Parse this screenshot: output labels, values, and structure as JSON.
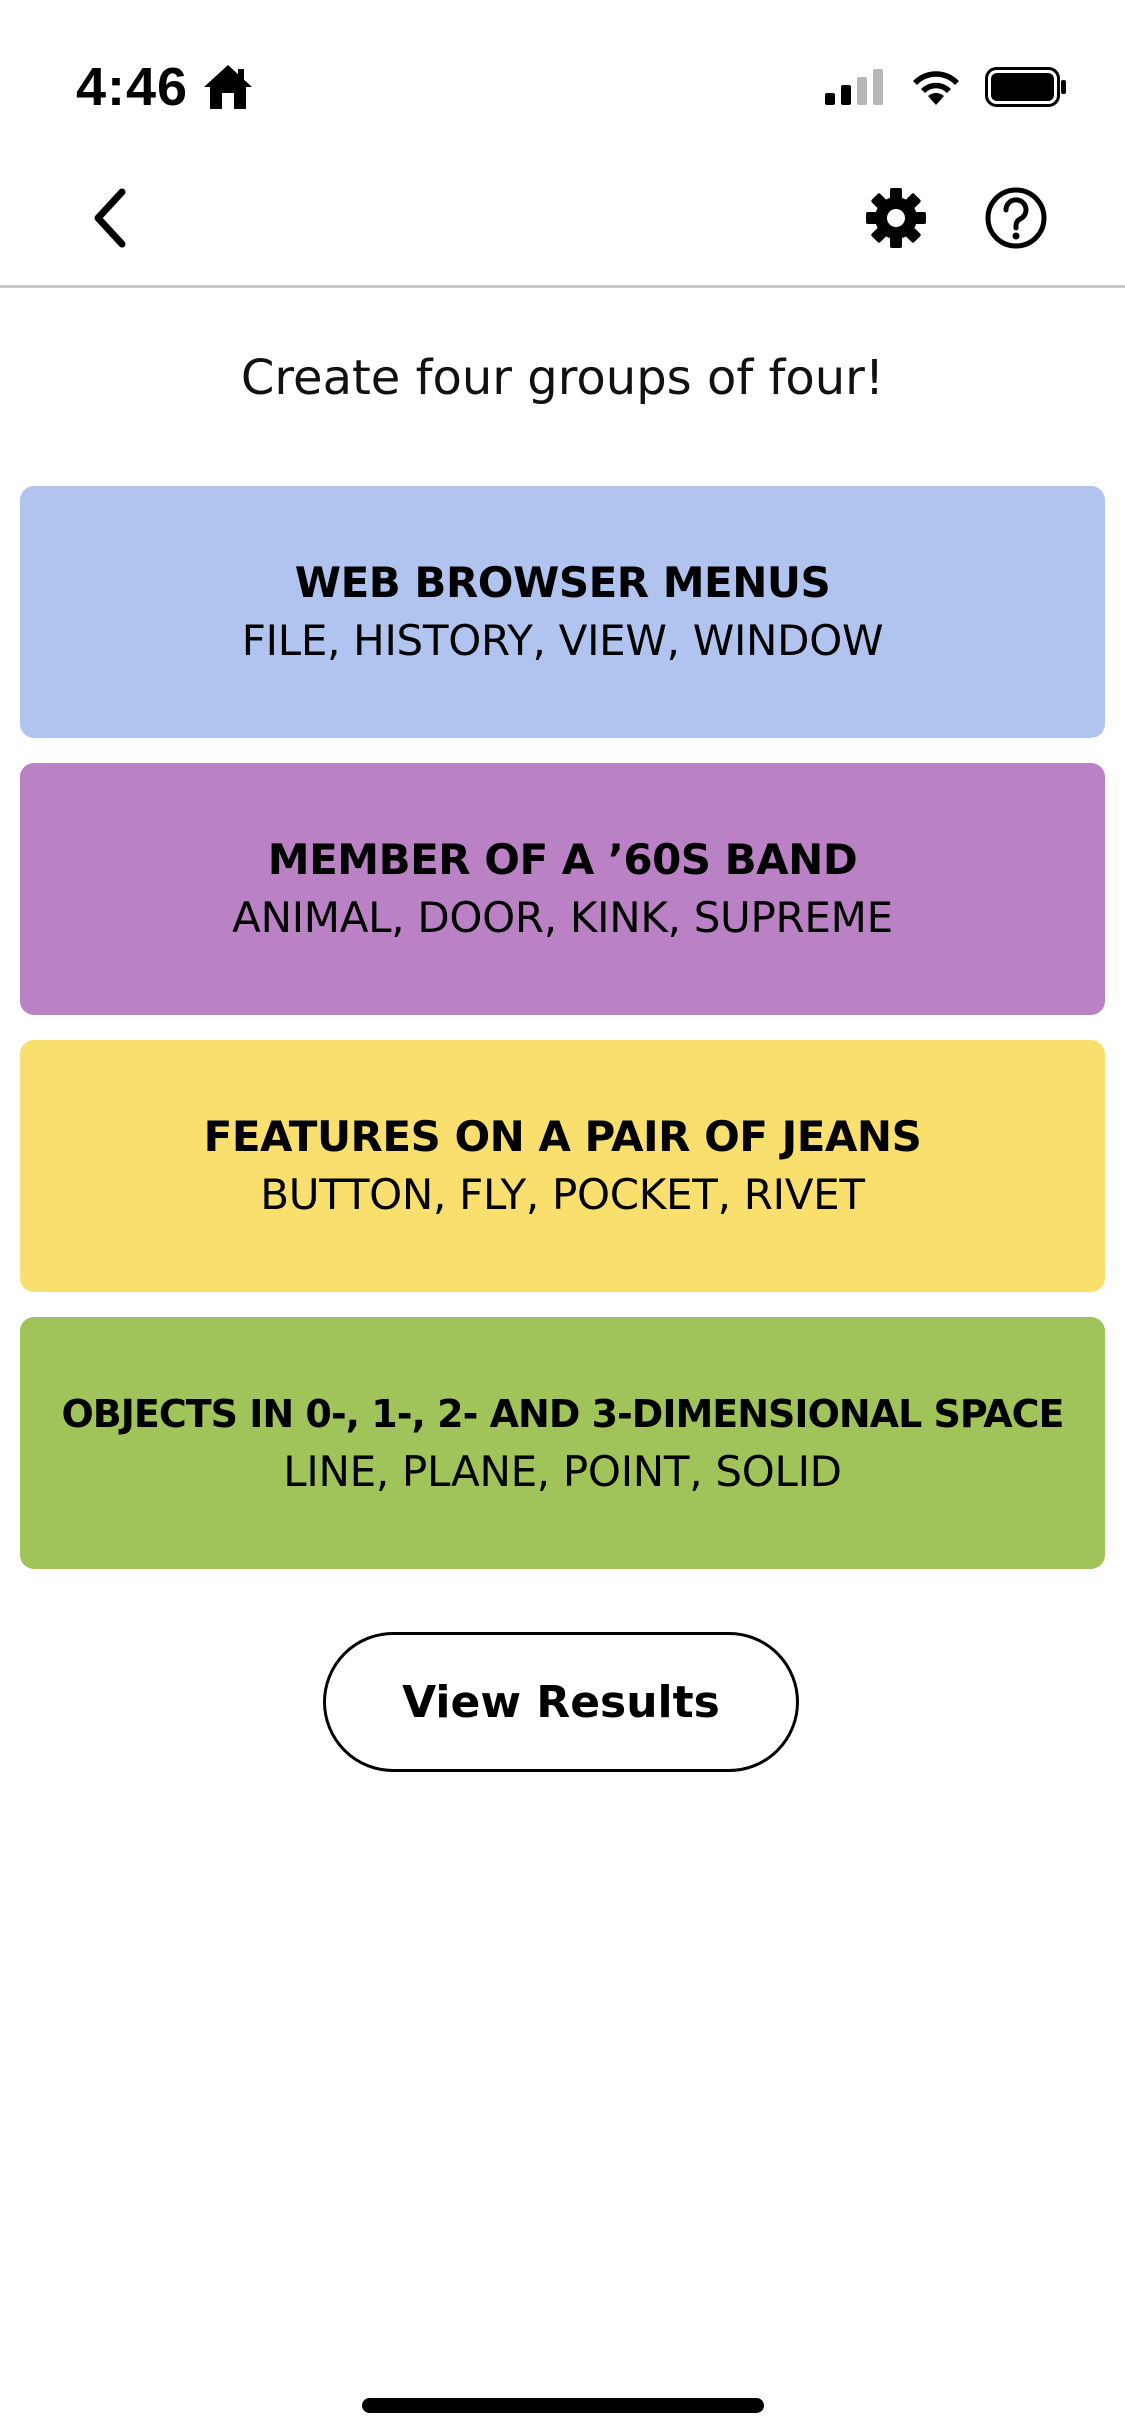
{
  "status_bar": {
    "time": "4:46",
    "icons": [
      "home-icon",
      "cellular-signal-icon",
      "wifi-icon",
      "battery-icon"
    ]
  },
  "nav": {
    "icons": [
      "chevron-left-icon",
      "gear-icon",
      "question-circle-icon"
    ]
  },
  "instructions": "Create four groups of four!",
  "groups": [
    {
      "title": "WEB BROWSER MENUS",
      "members": "FILE, HISTORY, VIEW, WINDOW",
      "color": "#b0c4ef"
    },
    {
      "title": "MEMBER OF A ’60S BAND",
      "members": "ANIMAL, DOOR, KINK, SUPREME",
      "color": "#ba81c5"
    },
    {
      "title": "FEATURES ON A PAIR OF JEANS",
      "members": "BUTTON, FLY, POCKET, RIVET",
      "color": "#f9df6d"
    },
    {
      "title": "OBJECTS IN 0-, 1-, 2- AND 3-DIMENSIONAL SPACE",
      "members": "LINE, PLANE, POINT, SOLID",
      "color": "#a0c35a"
    }
  ],
  "results_button_label": "View Results"
}
